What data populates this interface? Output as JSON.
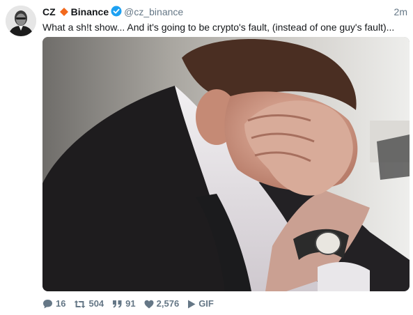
{
  "tweet": {
    "author_name": "CZ",
    "company": "Binance",
    "handle": "@cz_binance",
    "timestamp": "2m",
    "text": "What a sh!t show... And it's going to be crypto's fault, (instead of one guy's fault)...",
    "media_type": "GIF"
  },
  "actions": {
    "replies": "16",
    "retweets": "504",
    "quotes": "91",
    "likes": "2,576"
  },
  "colors": {
    "diamond": "#f2691d",
    "verified": "#1da1f2",
    "muted": "#657786"
  },
  "icons": [
    "diamond-icon",
    "verified-badge-icon",
    "reply-icon",
    "retweet-icon",
    "quote-icon",
    "like-icon",
    "play-icon"
  ]
}
